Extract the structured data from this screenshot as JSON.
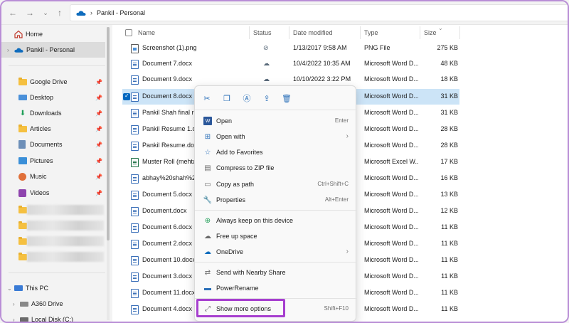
{
  "address": {
    "location": "Pankil - Personal"
  },
  "sidebar": {
    "items": [
      {
        "label": "Home"
      },
      {
        "label": "Pankil - Personal"
      },
      {
        "label": "Google Drive"
      },
      {
        "label": "Desktop"
      },
      {
        "label": "Downloads"
      },
      {
        "label": "Articles"
      },
      {
        "label": "Documents"
      },
      {
        "label": "Pictures"
      },
      {
        "label": "Music"
      },
      {
        "label": "Videos"
      },
      {
        "label": "This PC"
      },
      {
        "label": "A360 Drive"
      },
      {
        "label": "Local Disk (C:)"
      }
    ]
  },
  "columns": {
    "name": "Name",
    "status": "Status",
    "date": "Date modified",
    "type": "Type",
    "size": "Size"
  },
  "files": [
    {
      "name": "Screenshot (1).png",
      "date": "1/13/2017 9:58 AM",
      "type": "PNG File",
      "size": "275 KB"
    },
    {
      "name": "Document 7.docx",
      "date": "10/4/2022 10:35 AM",
      "type": "Microsoft Word D...",
      "size": "48 KB"
    },
    {
      "name": "Document 9.docx",
      "date": "10/10/2022 3:22 PM",
      "type": "Microsoft Word D...",
      "size": "18 KB"
    },
    {
      "name": "Document 8.docx",
      "date": "",
      "type": "Microsoft Word D...",
      "size": "31 KB"
    },
    {
      "name": "Pankil Shah final resume.docx",
      "date": "",
      "type": "Microsoft Word D...",
      "size": "31 KB"
    },
    {
      "name": "Pankil Resume 1.docx",
      "date": "",
      "type": "Microsoft Word D...",
      "size": "28 KB"
    },
    {
      "name": "Pankil Resume.docx",
      "date": "",
      "type": "Microsoft Word D...",
      "size": "28 KB"
    },
    {
      "name": "Muster Roll (mehta Sir).xlsx",
      "date": "",
      "type": "Microsoft Excel W...",
      "size": "17 KB"
    },
    {
      "name": "abhay%20shah%20abc.docx",
      "date": "",
      "type": "Microsoft Word D...",
      "size": "16 KB"
    },
    {
      "name": "Document 5.docx",
      "date": "",
      "type": "Microsoft Word D...",
      "size": "13 KB"
    },
    {
      "name": "Document.docx",
      "date": "",
      "type": "Microsoft Word D...",
      "size": "12 KB"
    },
    {
      "name": "Document 6.docx",
      "date": "",
      "type": "Microsoft Word D...",
      "size": "11 KB"
    },
    {
      "name": "Document 2.docx",
      "date": "",
      "type": "Microsoft Word D...",
      "size": "11 KB"
    },
    {
      "name": "Document 10.docx",
      "date": "",
      "type": "Microsoft Word D...",
      "size": "11 KB"
    },
    {
      "name": "Document 3.docx",
      "date": "",
      "type": "Microsoft Word D...",
      "size": "11 KB"
    },
    {
      "name": "Document 11.docx",
      "date": "",
      "type": "Microsoft Word D...",
      "size": "11 KB"
    },
    {
      "name": "Document 4.docx",
      "date": "",
      "type": "Microsoft Word D...",
      "size": "11 KB"
    }
  ],
  "context_menu": {
    "items": [
      {
        "label": "Open",
        "shortcut": "Enter"
      },
      {
        "label": "Open with",
        "shortcut": ""
      },
      {
        "label": "Add to Favorites",
        "shortcut": ""
      },
      {
        "label": "Compress to ZIP file",
        "shortcut": ""
      },
      {
        "label": "Copy as path",
        "shortcut": "Ctrl+Shift+C"
      },
      {
        "label": "Properties",
        "shortcut": "Alt+Enter"
      },
      {
        "label": "Always keep on this device",
        "shortcut": ""
      },
      {
        "label": "Free up space",
        "shortcut": ""
      },
      {
        "label": "OneDrive",
        "shortcut": ""
      },
      {
        "label": "Send with Nearby Share",
        "shortcut": ""
      },
      {
        "label": "PowerRename",
        "shortcut": ""
      },
      {
        "label": "Show more options",
        "shortcut": "Shift+F10"
      }
    ]
  },
  "colors": {
    "accent": "#0067c0",
    "highlight": "#a63fcf",
    "selection": "#cce4f7"
  }
}
